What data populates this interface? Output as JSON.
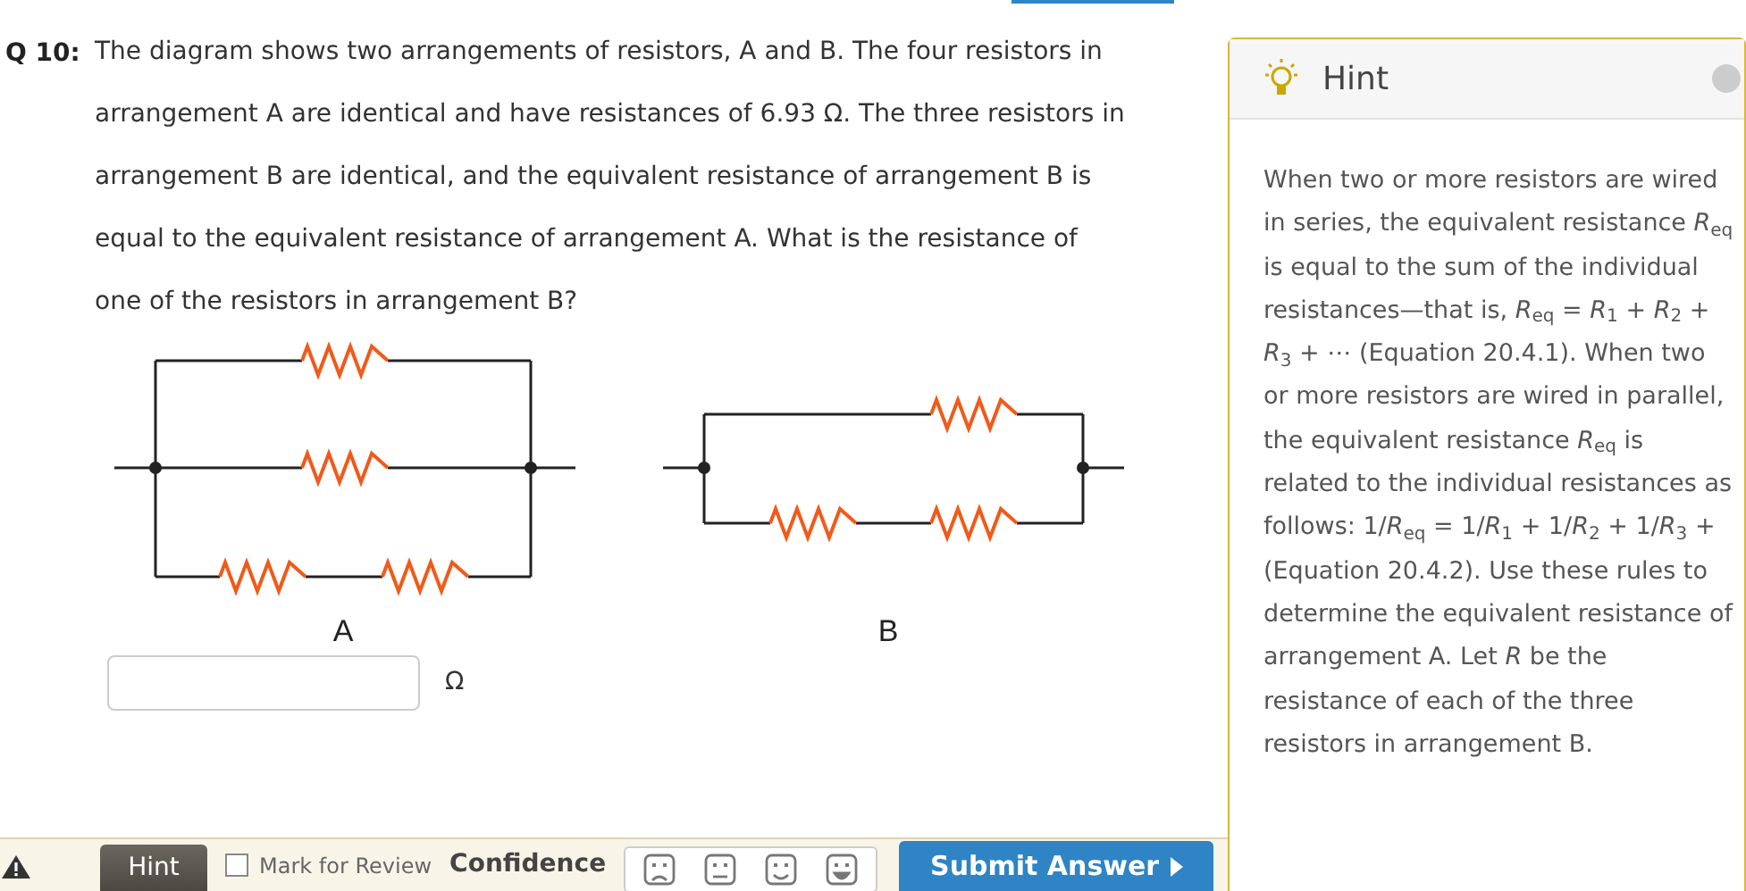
{
  "question": {
    "number": "Q 10:",
    "text": "The diagram shows two arrangements of resistors, A and B. The four resistors in arrangement A are identical and have resistances of 6.93 Ω. The three resistors in arrangement B are identical, and the equivalent resistance of arrangement B is equal to the equivalent resistance of arrangement A. What is the resistance of one of the resistors in arrangement B?"
  },
  "diagram": {
    "labels": [
      "A",
      "B"
    ]
  },
  "answer": {
    "unit": "Ω"
  },
  "toolbar": {
    "hint_button": "Hint",
    "mark_for_review": {
      "label": "Mark for Review",
      "checked": false
    },
    "confidence_label": "Confidence",
    "submit_button": "Submit Answer"
  },
  "hint": {
    "title": "Hint",
    "text": "When two or more resistors are wired in series, the equivalent resistance *R*$_{eq}$ is equal to the sum of the individual resistances—that is, *R*$_{eq}$ = *R*$_{1}$ + *R*$_{2}$ + *R*$_{3}$ + ⋯ (Equation 20.4.1). When two or more resistors are wired in parallel, the equivalent resistance *R*$_{eq}$ is related to the individual resistances as follows: 1/*R*$_{eq}$ = 1/*R*$_{1}$ + 1/*R*$_{2}$ + 1/*R*$_{3}$ + (Equation 20.4.2). Use these rules to determine the equivalent resistance of arrangement A. Let *R* be the resistance of each of the three resistors in arrangement B."
  }
}
